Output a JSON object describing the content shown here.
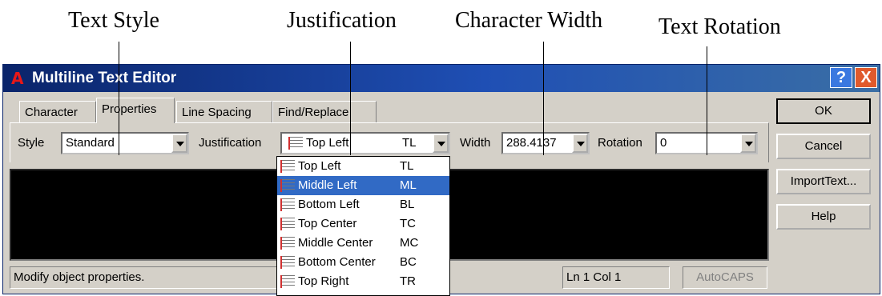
{
  "callouts": {
    "text_style": "Text Style",
    "justification": "Justification",
    "character_width": "Character Width",
    "text_rotation": "Text Rotation"
  },
  "window": {
    "title": "Multiline Text Editor",
    "help_glyph": "?",
    "close_glyph": "X"
  },
  "tabs": [
    {
      "label": "Character"
    },
    {
      "label": "Properties",
      "active": true
    },
    {
      "label": "Line Spacing"
    },
    {
      "label": "Find/Replace"
    }
  ],
  "properties": {
    "style_label": "Style",
    "style_value": "Standard",
    "justification_label": "Justification",
    "justification_value": "Top Left",
    "justification_code": "TL",
    "width_label": "Width",
    "width_value": "288.4137",
    "rotation_label": "Rotation",
    "rotation_value": "0"
  },
  "justification_options": [
    {
      "name": "Top Left",
      "code": "TL",
      "icon": "top-left-justify-icon"
    },
    {
      "name": "Middle Left",
      "code": "ML",
      "icon": "middle-left-justify-icon",
      "selected": true
    },
    {
      "name": "Bottom Left",
      "code": "BL",
      "icon": "bottom-left-justify-icon"
    },
    {
      "name": "Top Center",
      "code": "TC",
      "icon": "top-center-justify-icon"
    },
    {
      "name": "Middle Center",
      "code": "MC",
      "icon": "middle-center-justify-icon"
    },
    {
      "name": "Bottom Center",
      "code": "BC",
      "icon": "bottom-center-justify-icon"
    },
    {
      "name": "Top Right",
      "code": "TR",
      "icon": "top-right-justify-icon"
    }
  ],
  "buttons": {
    "ok": "OK",
    "cancel": "Cancel",
    "import_text": "ImportText...",
    "help": "Help"
  },
  "status": {
    "message": "Modify object properties.",
    "position": "Ln 1 Col 1",
    "autocaps": "AutoCAPS"
  },
  "colors": {
    "titlebar": "#0a246a",
    "selection": "#316ac5",
    "editor_bg": "#000000",
    "dialog_bg": "#d4d0c8"
  }
}
